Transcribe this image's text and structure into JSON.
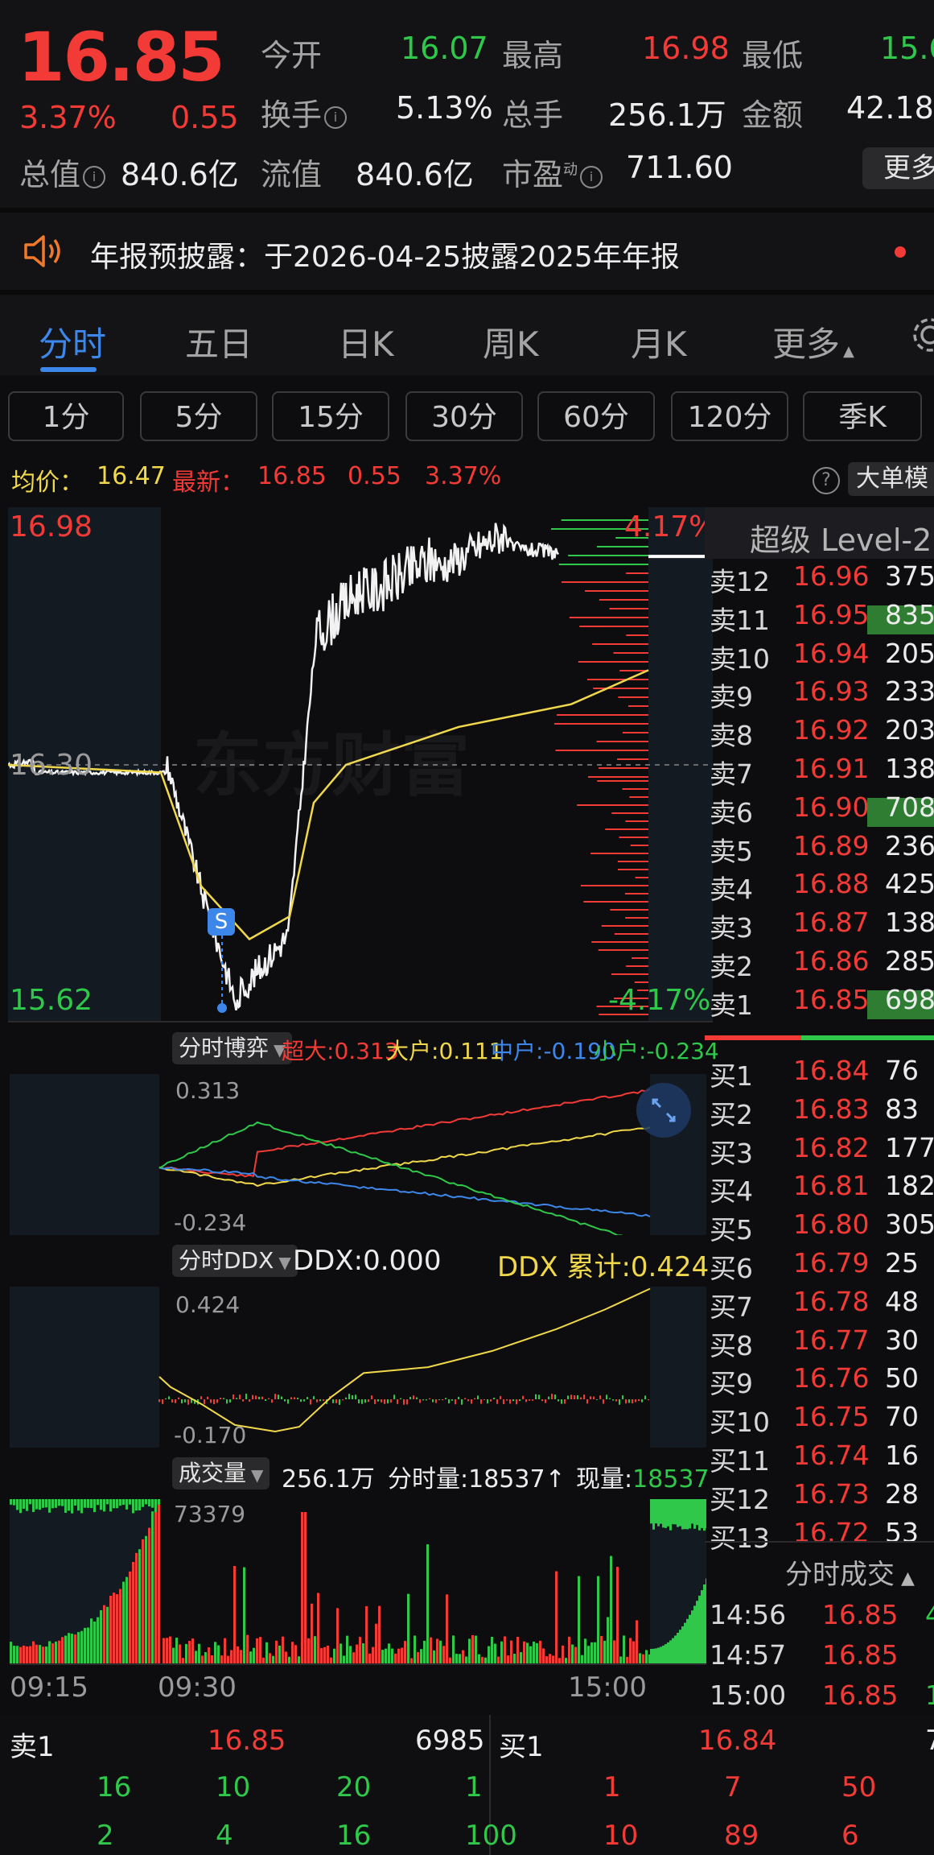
{
  "quote": {
    "price": "16.85",
    "change_pct": "3.37%",
    "change": "0.55",
    "open_label": "今开",
    "open": "16.07",
    "high_label": "最高",
    "high": "16.98",
    "low_label": "最低",
    "low": "15.6",
    "turnover_label": "换手",
    "turnover": "5.13%",
    "volume_label": "总手",
    "volume": "256.1万",
    "amount_label": "金额",
    "amount": "42.18",
    "mktcap_label": "总值",
    "mktcap": "840.6亿",
    "float_label": "流值",
    "float": "840.6亿",
    "pe_label": "市盈",
    "pe_sup": "动",
    "pe": "711.60",
    "more_label": "更多"
  },
  "notice": {
    "text": "年报预披露：于2026-04-25披露2025年年报"
  },
  "tabs": [
    "分时",
    "五日",
    "日K",
    "周K",
    "月K",
    "更多"
  ],
  "periods": [
    "1分",
    "5分",
    "15分",
    "30分",
    "60分",
    "120分",
    "季K"
  ],
  "avg_line": {
    "avg_label": "均价：",
    "avg": "16.47",
    "latest_label": "最新：",
    "latest": "16.85",
    "chg": "0.55",
    "pct": "3.37%"
  },
  "big_order_label": "大单模",
  "main_chart": {
    "top": "16.98",
    "mid": "16.30",
    "bottom": "15.62",
    "top_pct": "4.17%",
    "bottom_pct": "-4.17%",
    "watermark": "东方财富",
    "marker": "S"
  },
  "level2": {
    "title": "超级 Level-2",
    "asks": [
      [
        "卖12",
        "16.96",
        "375"
      ],
      [
        "卖11",
        "16.95",
        "835"
      ],
      [
        "卖10",
        "16.94",
        "205"
      ],
      [
        "卖9",
        "16.93",
        "233"
      ],
      [
        "卖8",
        "16.92",
        "203"
      ],
      [
        "卖7",
        "16.91",
        "138"
      ],
      [
        "卖6",
        "16.90",
        "708"
      ],
      [
        "卖5",
        "16.89",
        "236"
      ],
      [
        "卖4",
        "16.88",
        "425"
      ],
      [
        "卖3",
        "16.87",
        "138"
      ],
      [
        "卖2",
        "16.86",
        "285"
      ],
      [
        "卖1",
        "16.85",
        "698"
      ]
    ],
    "bids": [
      [
        "买1",
        "16.84",
        "76"
      ],
      [
        "买2",
        "16.83",
        "83"
      ],
      [
        "买3",
        "16.82",
        "177"
      ],
      [
        "买4",
        "16.81",
        "182"
      ],
      [
        "买5",
        "16.80",
        "305"
      ],
      [
        "买6",
        "16.79",
        "25"
      ],
      [
        "买7",
        "16.78",
        "48"
      ],
      [
        "买8",
        "16.77",
        "30"
      ],
      [
        "买9",
        "16.76",
        "50"
      ],
      [
        "买10",
        "16.75",
        "70"
      ],
      [
        "买11",
        "16.74",
        "16"
      ],
      [
        "买12",
        "16.73",
        "28"
      ],
      [
        "买13",
        "16.72",
        "53"
      ]
    ],
    "trades_title": "分时成交",
    "trades": [
      [
        "14:56",
        "16.85",
        "4"
      ],
      [
        "14:57",
        "16.85",
        ""
      ],
      [
        "15:00",
        "16.85",
        "1."
      ]
    ]
  },
  "game": {
    "selector": "分时博弈",
    "super_label": "超大:",
    "super": "0.313",
    "big_label": "大户:",
    "big": "0.111",
    "mid_label": "中户:",
    "mid": "-0.190",
    "small_label": "小户:",
    "small": "-0.234",
    "max": "0.313",
    "min": "-0.234"
  },
  "ddx": {
    "selector": "分时DDX",
    "ddx_label": "DDX:",
    "ddx": "0.000",
    "cum_label": "DDX 累计:",
    "cum": "0.424",
    "max": "0.424",
    "min": "-0.170"
  },
  "vol": {
    "selector": "成交量",
    "total": "256.1万",
    "minute_label": "分时量:",
    "minute": "18537↑",
    "now_label": "现量:",
    "now": "18537",
    "max": "73379"
  },
  "time_axis": {
    "t1": "09:15",
    "t2": "09:30",
    "t3": "15:00"
  },
  "bottom": {
    "sell_label": "卖1",
    "sell_price": "16.85",
    "sell_qty": "6985",
    "buy_label": "买1",
    "buy_price": "16.84",
    "buy_qty": "7",
    "sell_rows": [
      [
        "16",
        "10",
        "20",
        "1"
      ],
      [
        "2",
        "4",
        "16",
        "100"
      ]
    ],
    "buy_rows": [
      [
        "1",
        "7",
        "50"
      ],
      [
        "10",
        "89",
        "6"
      ]
    ]
  },
  "colors": {
    "up": "#f23a36",
    "down": "#2fc84a",
    "accent": "#3e87ea",
    "avg": "#f0d84a"
  }
}
